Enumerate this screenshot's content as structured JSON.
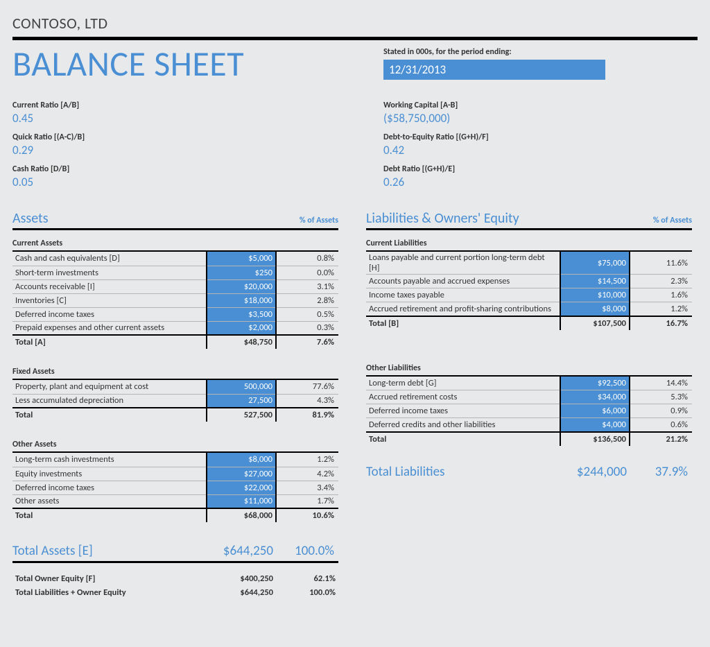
{
  "company": "CONTOSO, LTD",
  "title": "BALANCE SHEET",
  "period_label": "Stated in 000s, for the period ending:",
  "period_value": "12/31/2013",
  "ratios_left": [
    {
      "label": "Current Ratio   [A/B]",
      "value": "0.45"
    },
    {
      "label": "Quick Ratio   [(A-C)/B]",
      "value": "0.29"
    },
    {
      "label": "Cash Ratio   [D/B]",
      "value": "0.05"
    }
  ],
  "ratios_right": [
    {
      "label": "Working Capital   [A-B]",
      "value": "($58,750,000)"
    },
    {
      "label": "Debt-to-Equity Ratio   [(G+H)/F]",
      "value": "0.42"
    },
    {
      "label": "Debt Ratio   [(G+H)/E]",
      "value": "0.26"
    }
  ],
  "left_section": {
    "title": "Assets",
    "pct": "% of Assets"
  },
  "right_section": {
    "title": "Liabilities & Owners' Equity",
    "pct": "% of Assets"
  },
  "current_assets": {
    "title": "Current Assets",
    "rows": [
      {
        "label": "Cash and cash equivalents   [D]",
        "val": "$5,000",
        "pct": "0.8%"
      },
      {
        "label": "Short-term investments",
        "val": "$250",
        "pct": "0.0%"
      },
      {
        "label": "Accounts receivable   [I]",
        "val": "$20,000",
        "pct": "3.1%"
      },
      {
        "label": "Inventories   [C]",
        "val": "$18,000",
        "pct": "2.8%"
      },
      {
        "label": "Deferred income taxes",
        "val": "$3,500",
        "pct": "0.5%"
      },
      {
        "label": "Prepaid expenses and other current assets",
        "val": "$2,000",
        "pct": "0.3%"
      }
    ],
    "total": {
      "label": "Total   [A]",
      "val": "$48,750",
      "pct": "7.6%"
    }
  },
  "fixed_assets": {
    "title": "Fixed Assets",
    "rows": [
      {
        "label": "Property, plant and equipment at cost",
        "val": "500,000",
        "pct": "77.6%"
      },
      {
        "label": "Less accumulated depreciation",
        "val": "27,500",
        "pct": "4.3%"
      }
    ],
    "total": {
      "label": "Total",
      "val": "527,500",
      "pct": "81.9%"
    }
  },
  "other_assets": {
    "title": "Other Assets",
    "rows": [
      {
        "label": "Long-term cash investments",
        "val": "$8,000",
        "pct": "1.2%"
      },
      {
        "label": "Equity investments",
        "val": "$27,000",
        "pct": "4.2%"
      },
      {
        "label": "Deferred income taxes",
        "val": "$22,000",
        "pct": "3.4%"
      },
      {
        "label": "Other assets",
        "val": "$11,000",
        "pct": "1.7%"
      }
    ],
    "total": {
      "label": "Total",
      "val": "$68,000",
      "pct": "10.6%"
    }
  },
  "total_assets": {
    "label": "Total Assets   [E]",
    "val": "$644,250",
    "pct": "100.0%"
  },
  "footer": [
    {
      "label": "Total Owner Equity   [F]",
      "val": "$400,250",
      "pct": "62.1%"
    },
    {
      "label": "Total Liabilities + Owner Equity",
      "val": "$644,250",
      "pct": "100.0%"
    }
  ],
  "current_liabilities": {
    "title": "Current Liabilities",
    "rows": [
      {
        "label": "Loans payable and current portion long-term debt   [H]",
        "val": "$75,000",
        "pct": "11.6%"
      },
      {
        "label": "Accounts payable and accrued expenses",
        "val": "$14,500",
        "pct": "2.3%"
      },
      {
        "label": "Income taxes payable",
        "val": "$10,000",
        "pct": "1.6%"
      },
      {
        "label": "Accrued retirement and profit-sharing contributions",
        "val": "$8,000",
        "pct": "1.2%"
      }
    ],
    "total": {
      "label": "Total   [B]",
      "val": "$107,500",
      "pct": "16.7%"
    }
  },
  "other_liabilities": {
    "title": "Other Liabilities",
    "rows": [
      {
        "label": "Long-term debt   [G]",
        "val": "$92,500",
        "pct": "14.4%"
      },
      {
        "label": "Accrued retirement costs",
        "val": "$34,000",
        "pct": "5.3%"
      },
      {
        "label": "Deferred income taxes",
        "val": "$6,000",
        "pct": "0.9%"
      },
      {
        "label": "Deferred credits and other liabilities",
        "val": "$4,000",
        "pct": "0.6%"
      }
    ],
    "total": {
      "label": "Total",
      "val": "$136,500",
      "pct": "21.2%"
    }
  },
  "total_liabilities": {
    "label": "Total Liabilities",
    "val": "$244,000",
    "pct": "37.9%"
  }
}
